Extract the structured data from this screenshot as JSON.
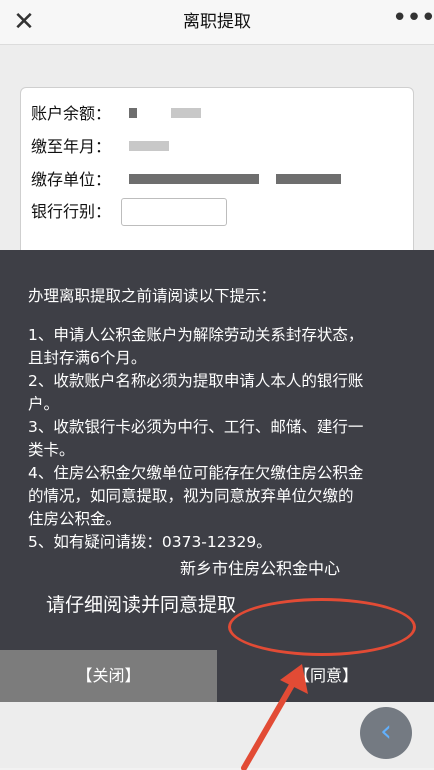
{
  "header": {
    "title": "离职提取",
    "close_glyph": "✕",
    "more_glyph": "•••"
  },
  "form": {
    "balance_label": "账户余额：",
    "paid_until_label": "缴至年月：",
    "employer_label": "缴存单位：",
    "bank_label": "银行行别："
  },
  "dialog": {
    "heading": "办理离职提取之前请阅读以下提示：",
    "tips": [
      "1、申请人公积金账户为解除劳动关系封存状态，",
      "且封存满6个月。",
      "2、收款账户名称必须为提取申请人本人的银行账",
      "户。",
      "3、收款银行卡必须为中行、工行、邮储、建行一",
      "类卡。",
      "4、住房公积金欠缴单位可能存在欠缴住房公积金",
      "的情况，如同意提取，视为同意放弃单位欠缴的",
      "住房公积金。",
      "5、如有疑问请拨：0373-12329。"
    ],
    "organization": "新乡市住房公积金中心",
    "prompt": "请仔细阅读并同意提取",
    "close_button": "【关闭】",
    "agree_button": "【同意】"
  },
  "fab": {
    "back_glyph": "‹"
  },
  "colors": {
    "dialog_bg": "#3e3f46",
    "close_btn_bg": "#7c7c7c",
    "highlight": "#e24b35",
    "fab_icon": "#4aa6ff"
  }
}
